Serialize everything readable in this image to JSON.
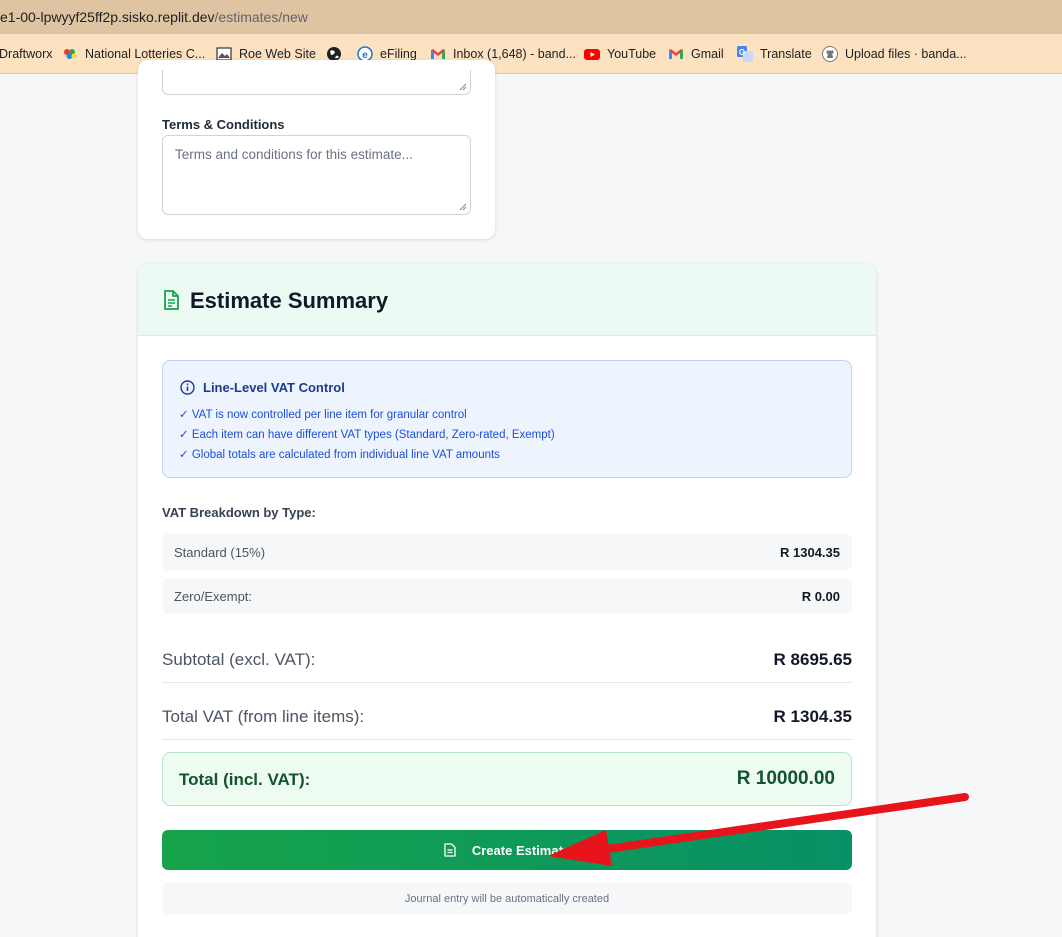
{
  "browser": {
    "url_host": "e1-00-lpwyyf25ff2p.sisko.replit.dev",
    "url_path": "/estimates/new",
    "bookmarks": [
      {
        "label": "Draftworx",
        "icon": "none"
      },
      {
        "label": "National Lotteries C...",
        "icon": "lottery-logo-icon"
      },
      {
        "label": "Roe Web Site",
        "icon": "image-icon"
      },
      {
        "label": "",
        "icon": "globe-icon"
      },
      {
        "label": "eFiling",
        "icon": "efiling-icon"
      },
      {
        "label": "Inbox (1,648) - band...",
        "icon": "gmail-icon"
      },
      {
        "label": "YouTube",
        "icon": "youtube-icon"
      },
      {
        "label": "Gmail",
        "icon": "gmail-icon"
      },
      {
        "label": "Translate",
        "icon": "translate-icon"
      },
      {
        "label": "Upload files · banda...",
        "icon": "github-icon"
      }
    ]
  },
  "form": {
    "terms_label": "Terms & Conditions",
    "terms_placeholder": "Terms and conditions for this estimate..."
  },
  "summary": {
    "title": "Estimate Summary",
    "info": {
      "title": "Line-Level VAT Control",
      "lines": [
        "✓ VAT is now controlled per line item for granular control",
        "✓ Each item can have different VAT types (Standard, Zero-rated, Exempt)",
        "✓ Global totals are calculated from individual line VAT amounts"
      ]
    },
    "vat_breakdown_title": "VAT Breakdown by Type:",
    "vat_breakdown": [
      {
        "label": "Standard (15%)",
        "value": "R 1304.35"
      },
      {
        "label": "Zero/Exempt:",
        "value": "R 0.00"
      }
    ],
    "subtotal_label": "Subtotal (excl. VAT):",
    "subtotal_value": "R 8695.65",
    "total_vat_label": "Total VAT (from line items):",
    "total_vat_value": "R 1304.35",
    "grand_total_label": "Total (incl. VAT):",
    "grand_total_value": "R 10000.00",
    "create_button_label": "Create Estimate",
    "journal_note": "Journal entry will be automatically created"
  },
  "colors": {
    "accent_green": "#16a34a",
    "annotation_arrow": "#e8141b"
  }
}
